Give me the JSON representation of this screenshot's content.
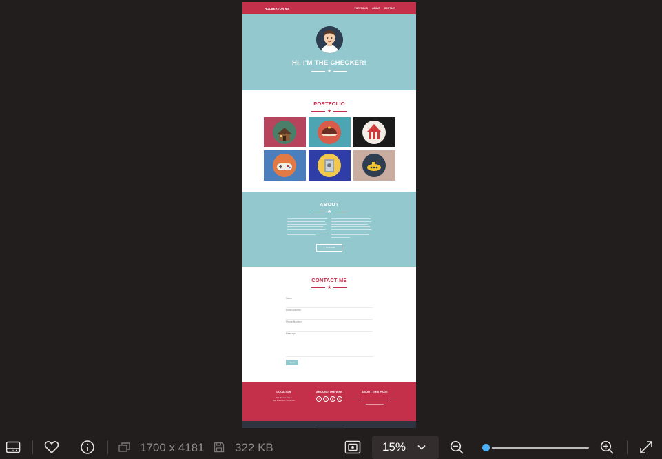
{
  "site": {
    "brand": "HOLBERTON ME",
    "nav_links": [
      "PORTFOLIO",
      "ABOUT",
      "CONTACT"
    ],
    "hero_title": "HI, I'M THE CHECKER!",
    "portfolio_title": "PORTFOLIO",
    "portfolio_tiles": [
      {
        "icon": "cabin-icon",
        "bg": "#b6445c"
      },
      {
        "icon": "cake-icon",
        "bg": "#4da5b4"
      },
      {
        "icon": "circus-tent-icon",
        "bg": "#1b1b1b"
      },
      {
        "icon": "game-controller-icon",
        "bg": "#4a7ebd"
      },
      {
        "icon": "safe-icon",
        "bg": "#2f3ea6"
      },
      {
        "icon": "submarine-icon",
        "bg": "#c9ada0"
      }
    ],
    "about_title": "ABOUT",
    "download_label": "Download",
    "contact_title": "CONTACT ME",
    "contact_fields": [
      "Name",
      "Email Address",
      "Phone Number",
      "Message"
    ],
    "send_label": "Send",
    "footer": {
      "location_head": "LOCATION",
      "location_line1": "372 Mission Street",
      "location_line2": "San Francisco, CA 94105",
      "web_head": "AROUND THE WEB",
      "social_icons": [
        "facebook-icon",
        "twitter-icon",
        "linkedin-icon",
        "dribbble-icon"
      ],
      "about_head": "ABOUT THIS PAGE"
    },
    "colors": {
      "primary": "#c4304a",
      "teal": "#93c8cf",
      "dark": "#2e3440"
    }
  },
  "viewer": {
    "dimensions": "1700 x 4181",
    "file_size": "322 KB",
    "zoom": "15%",
    "zoom_slider_level": 0.0
  }
}
